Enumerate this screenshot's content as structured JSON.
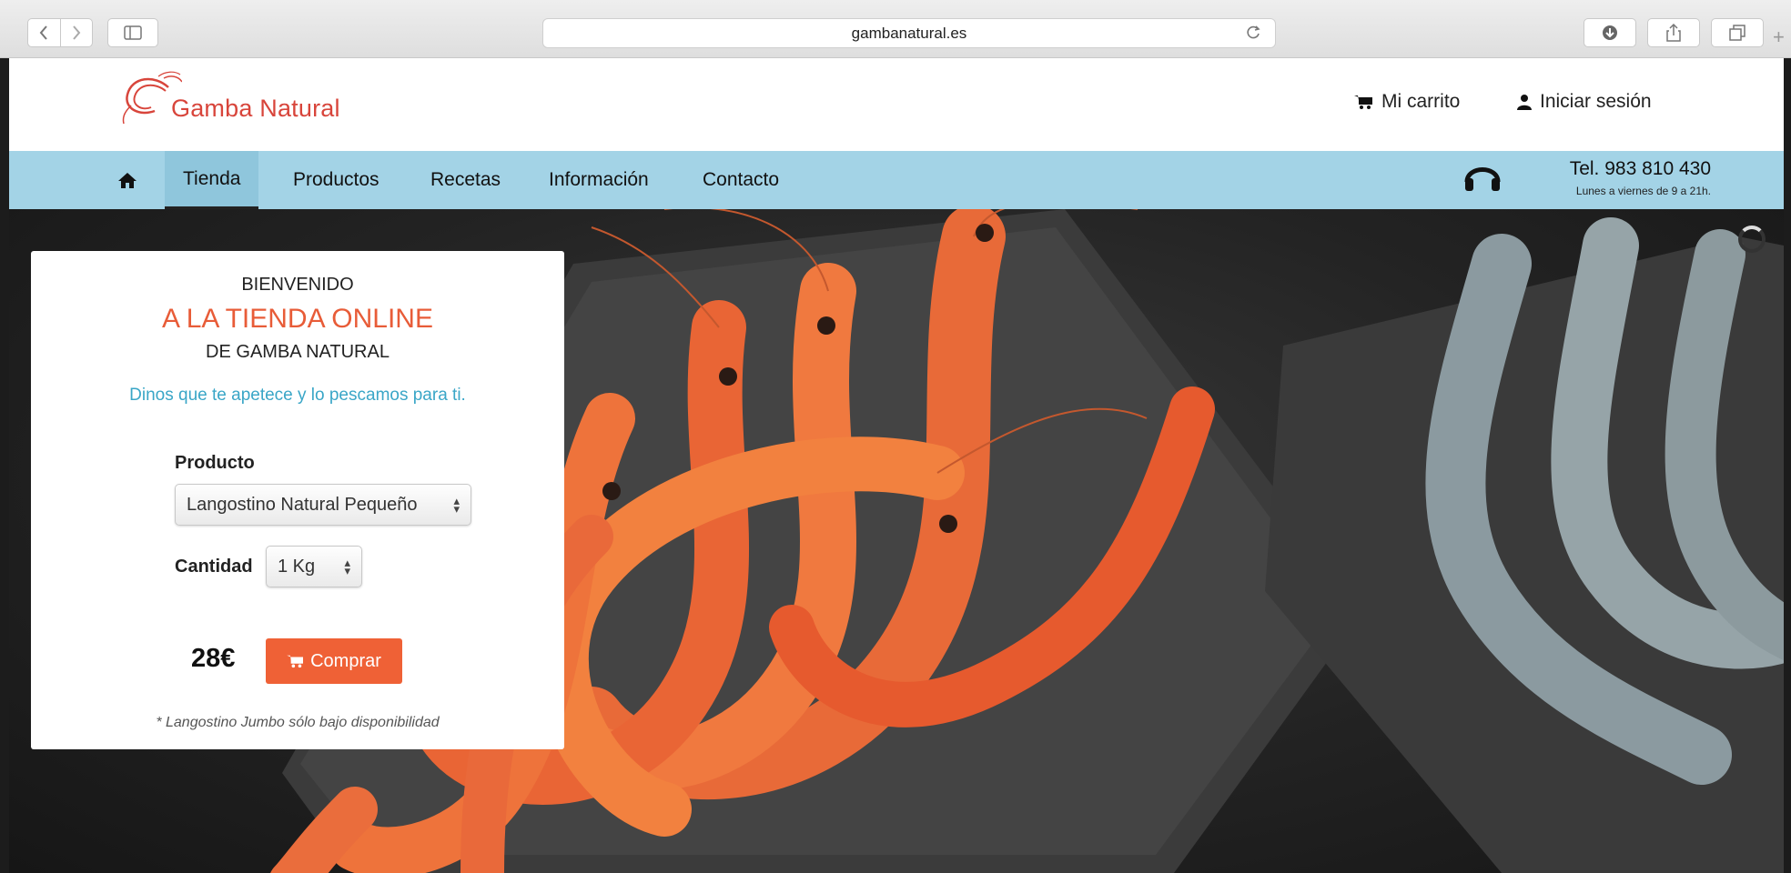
{
  "browser": {
    "url": "gambanatural.es"
  },
  "header": {
    "logo_text": "Gamba Natural",
    "cart_label": "Mi carrito",
    "login_label": "Iniciar sesión"
  },
  "nav": {
    "items": [
      {
        "label": "Tienda",
        "active": true
      },
      {
        "label": "Productos"
      },
      {
        "label": "Recetas"
      },
      {
        "label": "Información"
      },
      {
        "label": "Contacto"
      }
    ],
    "phone": "Tel. 983 810 430",
    "hours": "Lunes a viernes de 9 a 21h."
  },
  "card": {
    "line1": "BIENVENIDO",
    "line2": "A LA TIENDA ONLINE",
    "line3": "DE GAMBA NATURAL",
    "tagline": "Dinos que te apetece y lo pescamos para ti.",
    "product_label": "Producto",
    "product_value": "Langostino Natural Pequeño",
    "quantity_label": "Cantidad",
    "quantity_value": "1 Kg",
    "price": "28€",
    "buy_label": "Comprar",
    "note": "* Langostino Jumbo sólo bajo disponibilidad"
  },
  "colors": {
    "accent": "#ef6136",
    "nav_bg": "#a3d3e6",
    "tagline": "#3aa6c7",
    "logo": "#d8453b"
  }
}
